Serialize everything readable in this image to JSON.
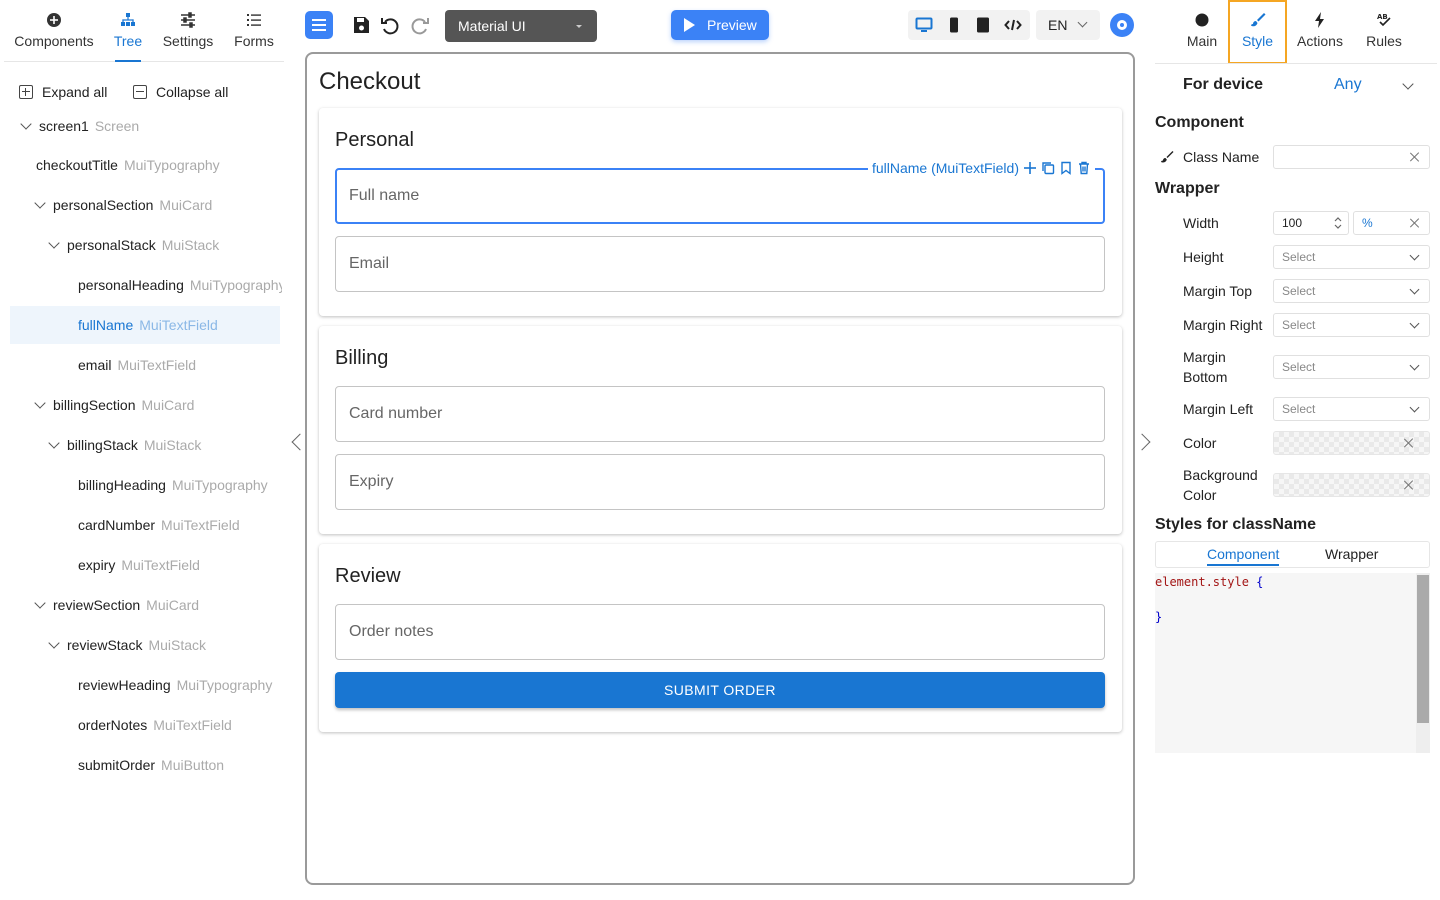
{
  "left_panel": {
    "tabs": [
      {
        "label": "Components",
        "icon": "plus-circle-icon"
      },
      {
        "label": "Tree",
        "icon": "hierarchy-icon",
        "active": true
      },
      {
        "label": "Settings",
        "icon": "sliders-icon"
      },
      {
        "label": "Forms",
        "icon": "list-icon"
      }
    ],
    "expand_all": "Expand all",
    "collapse_all": "Collapse all",
    "tree": [
      {
        "name": "screen1",
        "type": "Screen",
        "depth": 0,
        "caret": true
      },
      {
        "name": "checkoutTitle",
        "type": "MuiTypography",
        "depth": 1,
        "caret": false
      },
      {
        "name": "personalSection",
        "type": "MuiCard",
        "depth": 1,
        "caret": true
      },
      {
        "name": "personalStack",
        "type": "MuiStack",
        "depth": 2,
        "caret": true
      },
      {
        "name": "personalHeading",
        "type": "MuiTypography",
        "depth": 3,
        "caret": false
      },
      {
        "name": "fullName",
        "type": "MuiTextField",
        "depth": 3,
        "caret": false,
        "selected": true
      },
      {
        "name": "email",
        "type": "MuiTextField",
        "depth": 3,
        "caret": false
      },
      {
        "name": "billingSection",
        "type": "MuiCard",
        "depth": 1,
        "caret": true
      },
      {
        "name": "billingStack",
        "type": "MuiStack",
        "depth": 2,
        "caret": true
      },
      {
        "name": "billingHeading",
        "type": "MuiTypography",
        "depth": 3,
        "caret": false
      },
      {
        "name": "cardNumber",
        "type": "MuiTextField",
        "depth": 3,
        "caret": false
      },
      {
        "name": "expiry",
        "type": "MuiTextField",
        "depth": 3,
        "caret": false
      },
      {
        "name": "reviewSection",
        "type": "MuiCard",
        "depth": 1,
        "caret": true
      },
      {
        "name": "reviewStack",
        "type": "MuiStack",
        "depth": 2,
        "caret": true
      },
      {
        "name": "reviewHeading",
        "type": "MuiTypography",
        "depth": 3,
        "caret": false
      },
      {
        "name": "orderNotes",
        "type": "MuiTextField",
        "depth": 3,
        "caret": false
      },
      {
        "name": "submitOrder",
        "type": "MuiButton",
        "depth": 3,
        "caret": false
      }
    ]
  },
  "toolbar": {
    "library": "Material UI",
    "preview": "Preview",
    "language": "EN",
    "accent": "#3b82f6"
  },
  "canvas": {
    "title": "Checkout",
    "sections": {
      "personal": "Personal",
      "billing": "Billing",
      "review": "Review"
    },
    "fields": {
      "full_name": "Full name",
      "email": "Email",
      "card_number": "Card number",
      "expiry": "Expiry",
      "order_notes": "Order notes"
    },
    "selected_badge": "fullName (MuiTextField)",
    "submit": "SUBMIT ORDER",
    "button_color": "#1976d2"
  },
  "right_panel": {
    "tabs": [
      {
        "label": "Main",
        "icon": "circle-icon"
      },
      {
        "label": "Style",
        "icon": "brush-icon",
        "active": true
      },
      {
        "label": "Actions",
        "icon": "bolt-icon"
      },
      {
        "label": "Rules",
        "icon": "abc-icon"
      }
    ],
    "for_device": "For device",
    "device_value": "Any",
    "component_header": "Component",
    "class_name_label": "Class Name",
    "wrapper_header": "Wrapper",
    "width_label": "Width",
    "width_value": "100",
    "width_unit": "%",
    "height_label": "Height",
    "margin_top_label": "Margin Top",
    "margin_right_label": "Margin Right",
    "margin_bottom_label_1": "Margin",
    "margin_bottom_label_2": "Bottom",
    "margin_left_label": "Margin Left",
    "color_label": "Color",
    "bg_color_label_1": "Background",
    "bg_color_label_2": "Color",
    "select_placeholder": "Select",
    "styles_header": "Styles for className",
    "subtab_component": "Component",
    "subtab_wrapper": "Wrapper",
    "code_selector": "element.style",
    "code_open": "{",
    "code_close": "}"
  }
}
